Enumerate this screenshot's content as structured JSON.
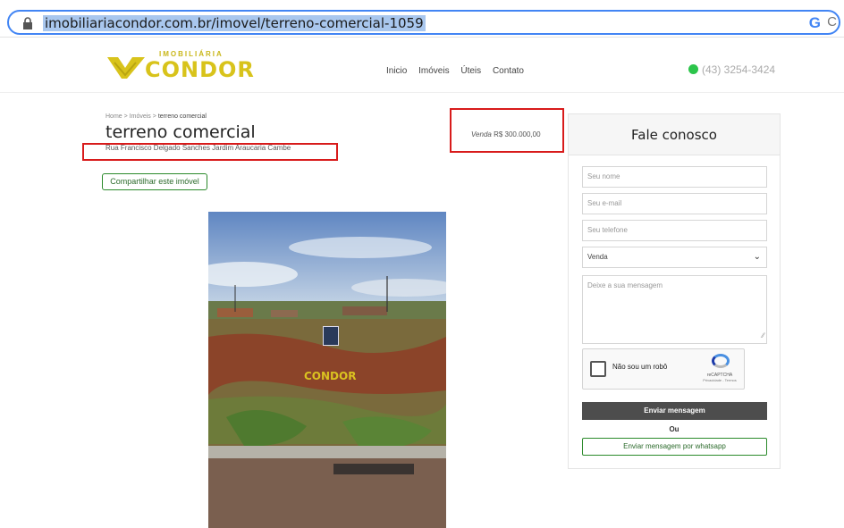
{
  "browser": {
    "url": "imobiliariacondor.com.br/imovel/terreno-comercial-1059",
    "g_icon": "G",
    "c_icon": "C"
  },
  "header": {
    "logo_top": "IMOBILIÁRIA",
    "logo_main": "CONDOR",
    "nav": [
      "Inicio",
      "Imóveis",
      "Úteis",
      "Contato"
    ],
    "phone": "(43) 3254-3424"
  },
  "property": {
    "breadcrumb": {
      "home": "Home",
      "sep": ">",
      "section": "Imóveis",
      "current": "terreno comercial"
    },
    "title": "terreno comercial",
    "address": "Rua Francisco Delgado Sanches Jardim Araucaria Cambe",
    "share_label": "Compartilhar este imóvel",
    "price_label": "Venda",
    "price_value": "R$ 300.000,00",
    "photo_watermark": "CONDOR"
  },
  "contact": {
    "title": "Fale conosco",
    "name_placeholder": "Seu nome",
    "email_placeholder": "Seu e-mail",
    "phone_placeholder": "Seu telefone",
    "type_selected": "Venda",
    "message_placeholder": "Deixe a sua mensagem",
    "captcha_label": "Não sou um robô",
    "captcha_brand": "reCAPTCHA",
    "captcha_links": "Privacidade - Termos",
    "send_label": "Enviar mensagem",
    "or_label": "Ou",
    "whatsapp_label": "Enviar mensagem por whatsapp"
  },
  "colors": {
    "highlight_box": "#d81b1b",
    "accent_green": "#2b8a2b",
    "logo_yellow": "#d8c31b",
    "send_button": "#4d4d4d"
  }
}
